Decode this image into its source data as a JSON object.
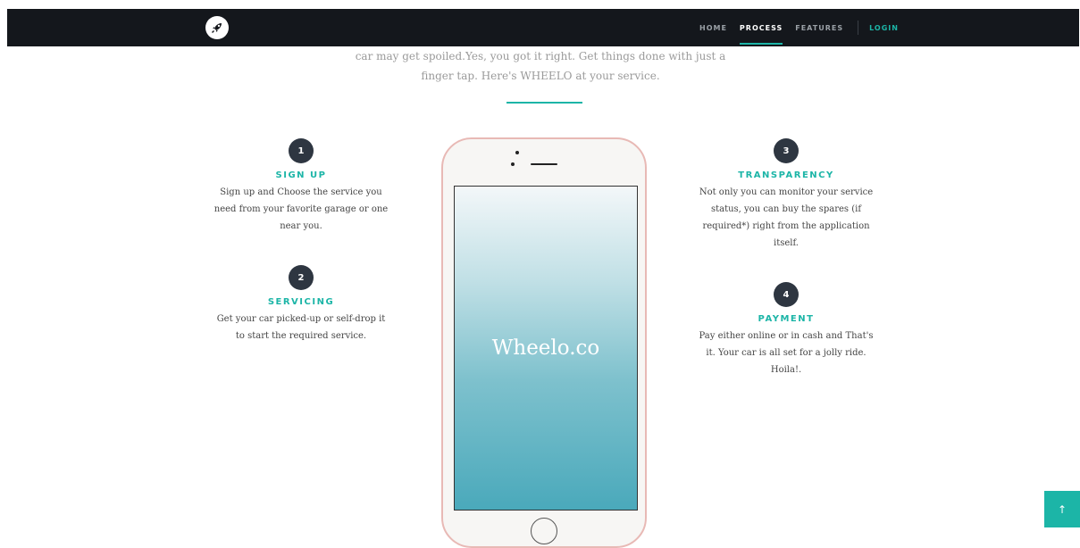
{
  "nav": {
    "items": [
      {
        "label": "HOME"
      },
      {
        "label": "PROCESS"
      },
      {
        "label": "FEATURES"
      }
    ],
    "login": "LOGIN"
  },
  "intro": {
    "line1": "car may get spoiled.Yes, you got it right. Get things done with just a",
    "line2": "finger tap. Here's WHEELO at your service."
  },
  "steps": [
    {
      "num": "1",
      "title": "SIGN UP",
      "desc": "Sign up and Choose the service you need from your favorite garage or one near you."
    },
    {
      "num": "2",
      "title": "SERVICING",
      "desc": "Get your car picked-up or self-drop it to start the required service."
    },
    {
      "num": "3",
      "title": "TRANSPARENCY",
      "desc": "Not only you can monitor your service status, you can buy the spares (if required*) right from the application itself."
    },
    {
      "num": "4",
      "title": "PAYMENT",
      "desc": "Pay either online or in cash and That's it. Your car is all set for a jolly ride. Hoila!."
    }
  ],
  "phone": {
    "screen_text": "Wheelo.co"
  },
  "colors": {
    "accent": "#1cb5a7",
    "navbar": "#14171c",
    "badge": "#2e3641"
  },
  "icons": {
    "logo": "rocket-icon",
    "scroll_top": "arrow-up-icon"
  }
}
